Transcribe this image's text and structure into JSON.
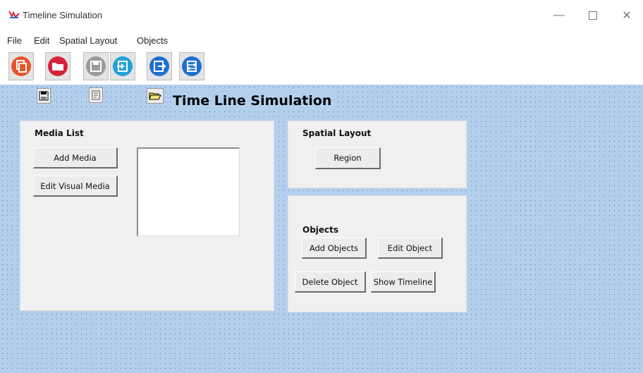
{
  "window": {
    "title": "Timeline Simulation"
  },
  "menu": {
    "items": [
      "File",
      "Edit",
      "Spatial Layout",
      "Objects"
    ]
  },
  "toolbar": {
    "buttons": [
      {
        "icon": "copy-icon",
        "color": "#e8542a"
      },
      {
        "icon": "folder-icon",
        "color": "#d6223a"
      },
      {
        "icon": "save-icon",
        "color": "#9a9a9a"
      },
      {
        "icon": "import-icon",
        "color": "#23a0d8"
      },
      {
        "icon": "export-icon",
        "color": "#1f6fd0"
      },
      {
        "icon": "transfer-icon",
        "color": "#1f6fd0"
      }
    ]
  },
  "canvas": {
    "heading": "Time Line Simulation"
  },
  "media_panel": {
    "title": "Media List",
    "add_label": "Add Media",
    "edit_label": "Edit Visual Media"
  },
  "spatial_panel": {
    "title": "Spatial Layout",
    "region_label": "Region"
  },
  "objects_panel": {
    "title": "Objects",
    "add_label": "Add Objects",
    "edit_label": "Edit Object",
    "delete_label": "Delete Object",
    "timeline_label": "Show Timeline"
  }
}
